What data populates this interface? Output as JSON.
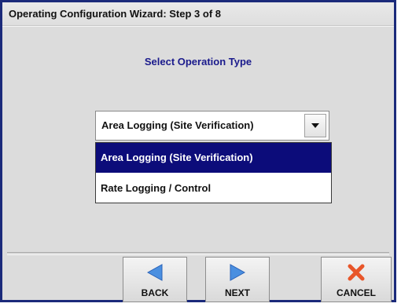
{
  "window": {
    "title": "Operating Configuration Wizard:  Step 3 of 8"
  },
  "main": {
    "heading": "Select Operation Type",
    "operation_type": {
      "selected_value": "Area Logging (Site Verification)",
      "options": [
        {
          "label": "Area Logging (Site Verification)",
          "highlighted": true
        },
        {
          "label": "Rate Logging / Control",
          "highlighted": false
        }
      ]
    }
  },
  "footer": {
    "back_label": "BACK",
    "next_label": "NEXT",
    "cancel_label": "CANCEL"
  },
  "colors": {
    "window_border": "#1b2a7a",
    "heading_text": "#1a1a8c",
    "highlight": "#0c0c7a",
    "nav_arrow": "#4a8fe0",
    "cancel_x": "#e8562a"
  },
  "icons": {
    "back": "arrow-left-icon",
    "next": "arrow-right-icon",
    "cancel": "x-mark-icon",
    "dropdown": "caret-down-icon"
  }
}
